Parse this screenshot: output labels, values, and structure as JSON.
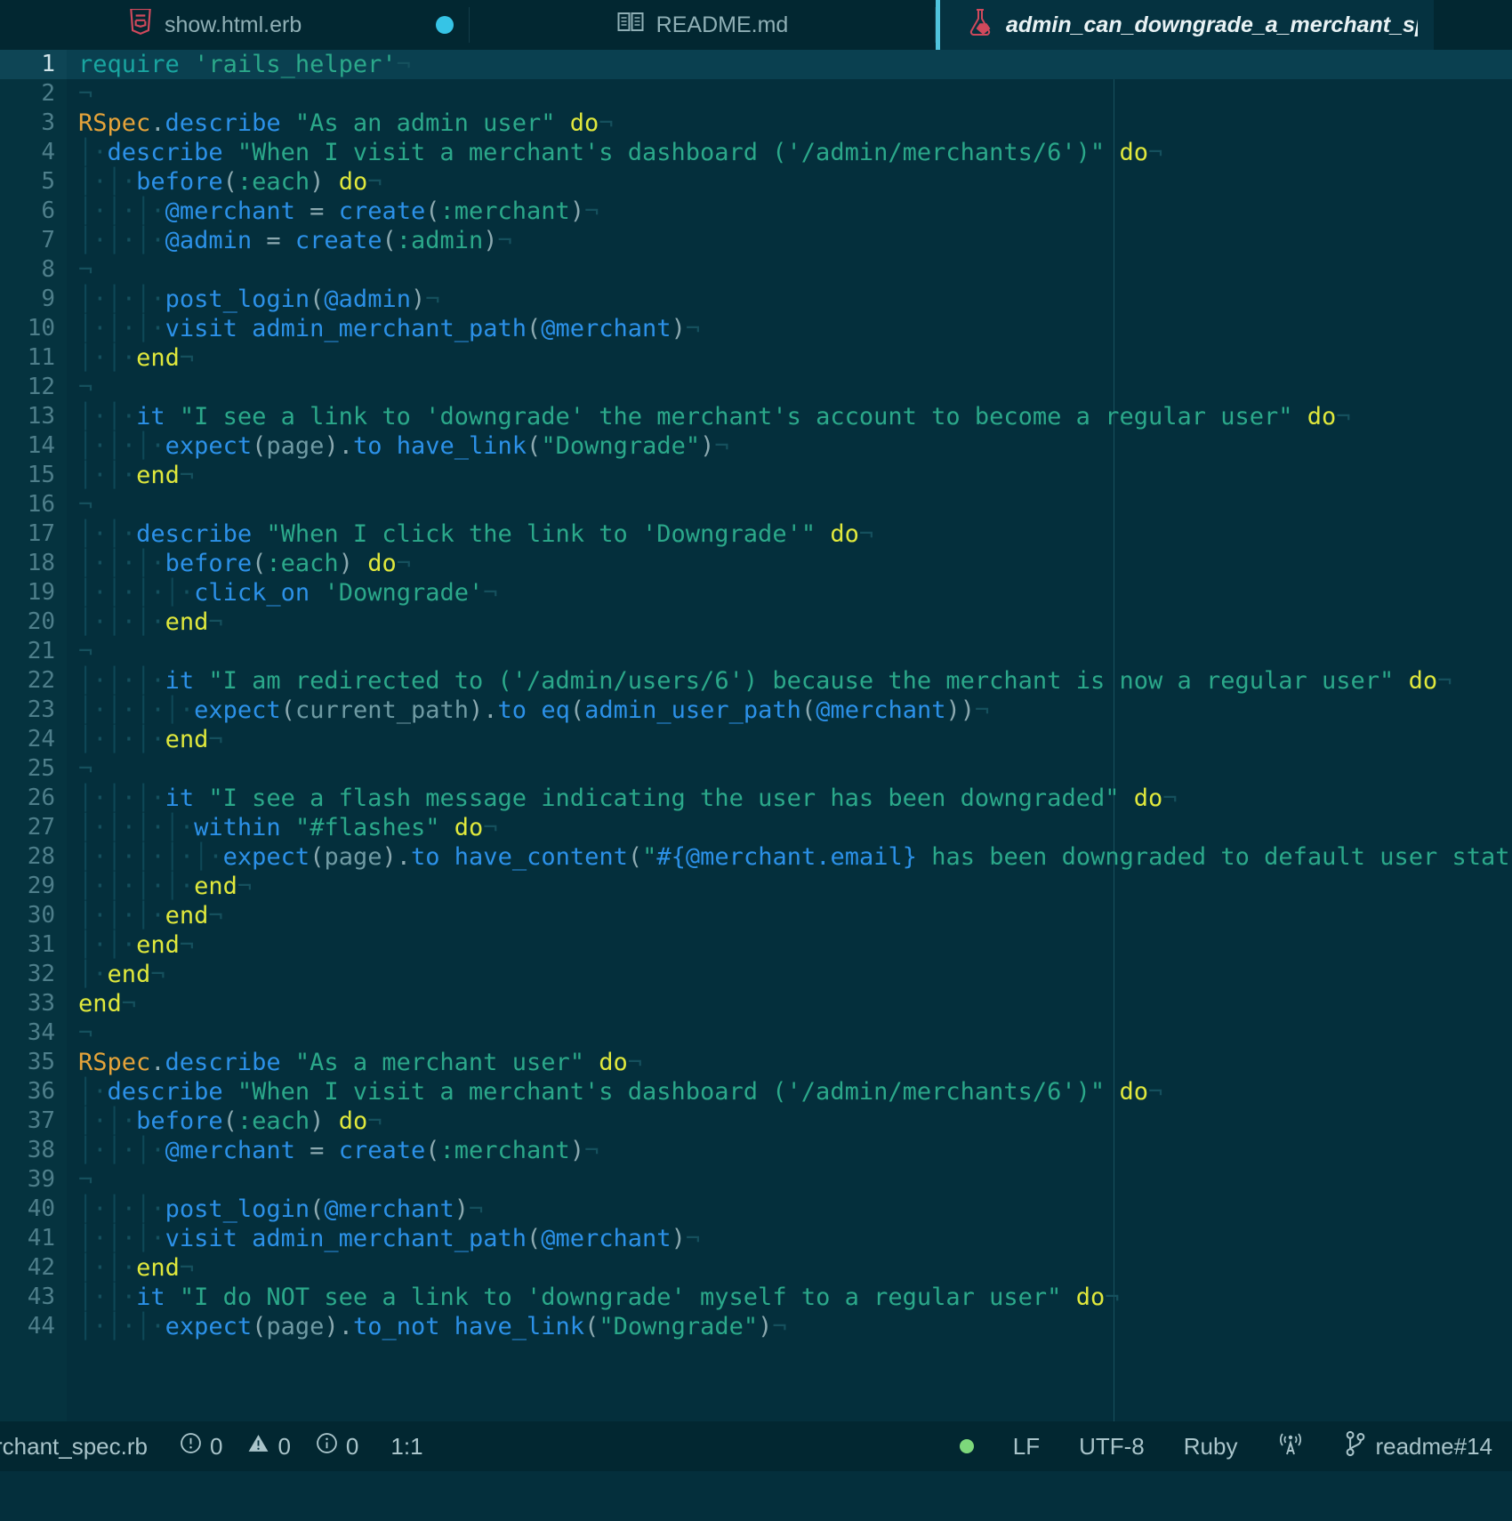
{
  "window": {
    "app": "code-editor",
    "theme_bg": "#042F3C"
  },
  "tabs": [
    {
      "label": "show.html.erb",
      "icon": "html5-icon",
      "modified": true,
      "active": false
    },
    {
      "label": "README.md",
      "icon": "book-icon",
      "modified": false,
      "active": false
    },
    {
      "label": "admin_can_downgrade_a_merchant_sp…",
      "icon": "ruby-test-flask-icon",
      "modified": false,
      "active": true
    }
  ],
  "editor": {
    "language": "Ruby",
    "current_line": 1,
    "lines": [
      {
        "n": "1",
        "indent": 0,
        "tokens": [
          {
            "t": "require",
            "c": "c-req"
          },
          {
            "t": " ",
            "c": "c-plain"
          },
          {
            "t": "'rails_helper'",
            "c": "c-str"
          }
        ]
      },
      {
        "n": "2",
        "indent": 0,
        "tokens": []
      },
      {
        "n": "3",
        "indent": 0,
        "tokens": [
          {
            "t": "RSpec",
            "c": "c-const"
          },
          {
            "t": ".",
            "c": "c-punc"
          },
          {
            "t": "describe",
            "c": "c-fn"
          },
          {
            "t": " ",
            "c": "c-plain"
          },
          {
            "t": "\"As an admin user\"",
            "c": "c-str"
          },
          {
            "t": " ",
            "c": "c-plain"
          },
          {
            "t": "do",
            "c": "c-kw"
          }
        ]
      },
      {
        "n": "4",
        "indent": 1,
        "tokens": [
          {
            "t": "describe",
            "c": "c-fn"
          },
          {
            "t": " ",
            "c": "c-plain"
          },
          {
            "t": "\"When I visit a merchant's dashboard ('/admin/merchants/6')\"",
            "c": "c-str"
          },
          {
            "t": " ",
            "c": "c-plain"
          },
          {
            "t": "do",
            "c": "c-kw"
          }
        ]
      },
      {
        "n": "5",
        "indent": 2,
        "tokens": [
          {
            "t": "before",
            "c": "c-fn"
          },
          {
            "t": "(",
            "c": "c-punc"
          },
          {
            "t": ":each",
            "c": "c-sym"
          },
          {
            "t": ")",
            "c": "c-punc"
          },
          {
            "t": " ",
            "c": "c-plain"
          },
          {
            "t": "do",
            "c": "c-kw"
          }
        ]
      },
      {
        "n": "6",
        "indent": 3,
        "tokens": [
          {
            "t": "@merchant",
            "c": "c-var"
          },
          {
            "t": " = ",
            "c": "c-punc"
          },
          {
            "t": "create",
            "c": "c-fn"
          },
          {
            "t": "(",
            "c": "c-punc"
          },
          {
            "t": ":merchant",
            "c": "c-sym"
          },
          {
            "t": ")",
            "c": "c-punc"
          }
        ]
      },
      {
        "n": "7",
        "indent": 3,
        "tokens": [
          {
            "t": "@admin",
            "c": "c-var"
          },
          {
            "t": " = ",
            "c": "c-punc"
          },
          {
            "t": "create",
            "c": "c-fn"
          },
          {
            "t": "(",
            "c": "c-punc"
          },
          {
            "t": ":admin",
            "c": "c-sym"
          },
          {
            "t": ")",
            "c": "c-punc"
          }
        ]
      },
      {
        "n": "8",
        "indent": 0,
        "tokens": []
      },
      {
        "n": "9",
        "indent": 3,
        "tokens": [
          {
            "t": "post_login",
            "c": "c-fn"
          },
          {
            "t": "(",
            "c": "c-punc"
          },
          {
            "t": "@admin",
            "c": "c-var"
          },
          {
            "t": ")",
            "c": "c-punc"
          }
        ]
      },
      {
        "n": "10",
        "indent": 3,
        "tokens": [
          {
            "t": "visit",
            "c": "c-fn"
          },
          {
            "t": " ",
            "c": "c-plain"
          },
          {
            "t": "admin_merchant_path",
            "c": "c-fn"
          },
          {
            "t": "(",
            "c": "c-punc"
          },
          {
            "t": "@merchant",
            "c": "c-var"
          },
          {
            "t": ")",
            "c": "c-punc"
          }
        ]
      },
      {
        "n": "11",
        "indent": 2,
        "tokens": [
          {
            "t": "end",
            "c": "c-kw"
          }
        ]
      },
      {
        "n": "12",
        "indent": 0,
        "tokens": []
      },
      {
        "n": "13",
        "indent": 2,
        "tokens": [
          {
            "t": "it",
            "c": "c-fn"
          },
          {
            "t": " ",
            "c": "c-plain"
          },
          {
            "t": "\"I see a link to 'downgrade' the merchant's account to become a regular user\"",
            "c": "c-str"
          },
          {
            "t": " ",
            "c": "c-plain"
          },
          {
            "t": "do",
            "c": "c-kw"
          }
        ]
      },
      {
        "n": "14",
        "indent": 3,
        "tokens": [
          {
            "t": "expect",
            "c": "c-fn"
          },
          {
            "t": "(",
            "c": "c-punc"
          },
          {
            "t": "page",
            "c": "c-plain"
          },
          {
            "t": ").",
            "c": "c-punc"
          },
          {
            "t": "to",
            "c": "c-fn"
          },
          {
            "t": " ",
            "c": "c-plain"
          },
          {
            "t": "have_link",
            "c": "c-fn"
          },
          {
            "t": "(",
            "c": "c-punc"
          },
          {
            "t": "\"Downgrade\"",
            "c": "c-str"
          },
          {
            "t": ")",
            "c": "c-punc"
          }
        ]
      },
      {
        "n": "15",
        "indent": 2,
        "tokens": [
          {
            "t": "end",
            "c": "c-kw"
          }
        ]
      },
      {
        "n": "16",
        "indent": 0,
        "tokens": []
      },
      {
        "n": "17",
        "indent": 2,
        "tokens": [
          {
            "t": "describe",
            "c": "c-fn"
          },
          {
            "t": " ",
            "c": "c-plain"
          },
          {
            "t": "\"When I click the link to 'Downgrade'\"",
            "c": "c-str"
          },
          {
            "t": " ",
            "c": "c-plain"
          },
          {
            "t": "do",
            "c": "c-kw"
          }
        ]
      },
      {
        "n": "18",
        "indent": 3,
        "tokens": [
          {
            "t": "before",
            "c": "c-fn"
          },
          {
            "t": "(",
            "c": "c-punc"
          },
          {
            "t": ":each",
            "c": "c-sym"
          },
          {
            "t": ")",
            "c": "c-punc"
          },
          {
            "t": " ",
            "c": "c-plain"
          },
          {
            "t": "do",
            "c": "c-kw"
          }
        ]
      },
      {
        "n": "19",
        "indent": 4,
        "tokens": [
          {
            "t": "click_on",
            "c": "c-fn"
          },
          {
            "t": " ",
            "c": "c-plain"
          },
          {
            "t": "'Downgrade'",
            "c": "c-str"
          }
        ]
      },
      {
        "n": "20",
        "indent": 3,
        "tokens": [
          {
            "t": "end",
            "c": "c-kw"
          }
        ]
      },
      {
        "n": "21",
        "indent": 0,
        "tokens": []
      },
      {
        "n": "22",
        "indent": 3,
        "tokens": [
          {
            "t": "it",
            "c": "c-fn"
          },
          {
            "t": " ",
            "c": "c-plain"
          },
          {
            "t": "\"I am redirected to ('/admin/users/6') because the merchant is now a regular user\"",
            "c": "c-str"
          },
          {
            "t": " ",
            "c": "c-plain"
          },
          {
            "t": "do",
            "c": "c-kw"
          }
        ]
      },
      {
        "n": "23",
        "indent": 4,
        "tokens": [
          {
            "t": "expect",
            "c": "c-fn"
          },
          {
            "t": "(",
            "c": "c-punc"
          },
          {
            "t": "current_path",
            "c": "c-plain"
          },
          {
            "t": ").",
            "c": "c-punc"
          },
          {
            "t": "to",
            "c": "c-fn"
          },
          {
            "t": " ",
            "c": "c-plain"
          },
          {
            "t": "eq",
            "c": "c-fn"
          },
          {
            "t": "(",
            "c": "c-punc"
          },
          {
            "t": "admin_user_path",
            "c": "c-fn"
          },
          {
            "t": "(",
            "c": "c-punc"
          },
          {
            "t": "@merchant",
            "c": "c-var"
          },
          {
            "t": "))",
            "c": "c-punc"
          }
        ]
      },
      {
        "n": "24",
        "indent": 3,
        "tokens": [
          {
            "t": "end",
            "c": "c-kw"
          }
        ]
      },
      {
        "n": "25",
        "indent": 0,
        "tokens": []
      },
      {
        "n": "26",
        "indent": 3,
        "tokens": [
          {
            "t": "it",
            "c": "c-fn"
          },
          {
            "t": " ",
            "c": "c-plain"
          },
          {
            "t": "\"I see a flash message indicating the user has been downgraded\"",
            "c": "c-str"
          },
          {
            "t": " ",
            "c": "c-plain"
          },
          {
            "t": "do",
            "c": "c-kw"
          }
        ]
      },
      {
        "n": "27",
        "indent": 4,
        "tokens": [
          {
            "t": "within",
            "c": "c-fn"
          },
          {
            "t": " ",
            "c": "c-plain"
          },
          {
            "t": "\"#flashes\"",
            "c": "c-str"
          },
          {
            "t": " ",
            "c": "c-plain"
          },
          {
            "t": "do",
            "c": "c-kw"
          }
        ]
      },
      {
        "n": "28",
        "indent": 5,
        "tokens": [
          {
            "t": "expect",
            "c": "c-fn"
          },
          {
            "t": "(",
            "c": "c-punc"
          },
          {
            "t": "page",
            "c": "c-plain"
          },
          {
            "t": ").",
            "c": "c-punc"
          },
          {
            "t": "to",
            "c": "c-fn"
          },
          {
            "t": " ",
            "c": "c-plain"
          },
          {
            "t": "have_content",
            "c": "c-fn"
          },
          {
            "t": "(",
            "c": "c-punc"
          },
          {
            "t": "\"",
            "c": "c-str"
          },
          {
            "t": "#{@merchant.email}",
            "c": "c-var"
          },
          {
            "t": " has been downgraded to default user status.\"",
            "c": "c-str"
          },
          {
            "t": ")",
            "c": "c-punc"
          }
        ]
      },
      {
        "n": "29",
        "indent": 4,
        "tokens": [
          {
            "t": "end",
            "c": "c-kw"
          }
        ]
      },
      {
        "n": "30",
        "indent": 3,
        "tokens": [
          {
            "t": "end",
            "c": "c-kw"
          }
        ]
      },
      {
        "n": "31",
        "indent": 2,
        "tokens": [
          {
            "t": "end",
            "c": "c-kw"
          }
        ]
      },
      {
        "n": "32",
        "indent": 1,
        "tokens": [
          {
            "t": "end",
            "c": "c-kw"
          }
        ]
      },
      {
        "n": "33",
        "indent": 0,
        "tokens": [
          {
            "t": "end",
            "c": "c-kw"
          }
        ]
      },
      {
        "n": "34",
        "indent": 0,
        "tokens": []
      },
      {
        "n": "35",
        "indent": 0,
        "tokens": [
          {
            "t": "RSpec",
            "c": "c-const"
          },
          {
            "t": ".",
            "c": "c-punc"
          },
          {
            "t": "describe",
            "c": "c-fn"
          },
          {
            "t": " ",
            "c": "c-plain"
          },
          {
            "t": "\"As a merchant user\"",
            "c": "c-str"
          },
          {
            "t": " ",
            "c": "c-plain"
          },
          {
            "t": "do",
            "c": "c-kw"
          }
        ]
      },
      {
        "n": "36",
        "indent": 1,
        "tokens": [
          {
            "t": "describe",
            "c": "c-fn"
          },
          {
            "t": " ",
            "c": "c-plain"
          },
          {
            "t": "\"When I visit a merchant's dashboard ('/admin/merchants/6')\"",
            "c": "c-str"
          },
          {
            "t": " ",
            "c": "c-plain"
          },
          {
            "t": "do",
            "c": "c-kw"
          }
        ]
      },
      {
        "n": "37",
        "indent": 2,
        "tokens": [
          {
            "t": "before",
            "c": "c-fn"
          },
          {
            "t": "(",
            "c": "c-punc"
          },
          {
            "t": ":each",
            "c": "c-sym"
          },
          {
            "t": ")",
            "c": "c-punc"
          },
          {
            "t": " ",
            "c": "c-plain"
          },
          {
            "t": "do",
            "c": "c-kw"
          }
        ]
      },
      {
        "n": "38",
        "indent": 3,
        "tokens": [
          {
            "t": "@merchant",
            "c": "c-var"
          },
          {
            "t": " = ",
            "c": "c-punc"
          },
          {
            "t": "create",
            "c": "c-fn"
          },
          {
            "t": "(",
            "c": "c-punc"
          },
          {
            "t": ":merchant",
            "c": "c-sym"
          },
          {
            "t": ")",
            "c": "c-punc"
          }
        ]
      },
      {
        "n": "39",
        "indent": 0,
        "tokens": []
      },
      {
        "n": "40",
        "indent": 3,
        "tokens": [
          {
            "t": "post_login",
            "c": "c-fn"
          },
          {
            "t": "(",
            "c": "c-punc"
          },
          {
            "t": "@merchant",
            "c": "c-var"
          },
          {
            "t": ")",
            "c": "c-punc"
          }
        ]
      },
      {
        "n": "41",
        "indent": 3,
        "tokens": [
          {
            "t": "visit",
            "c": "c-fn"
          },
          {
            "t": " ",
            "c": "c-plain"
          },
          {
            "t": "admin_merchant_path",
            "c": "c-fn"
          },
          {
            "t": "(",
            "c": "c-punc"
          },
          {
            "t": "@merchant",
            "c": "c-var"
          },
          {
            "t": ")",
            "c": "c-punc"
          }
        ]
      },
      {
        "n": "42",
        "indent": 2,
        "tokens": [
          {
            "t": "end",
            "c": "c-kw"
          }
        ]
      },
      {
        "n": "43",
        "indent": 2,
        "tokens": [
          {
            "t": "it",
            "c": "c-fn"
          },
          {
            "t": " ",
            "c": "c-plain"
          },
          {
            "t": "\"I do NOT see a link to 'downgrade' myself to a regular user\"",
            "c": "c-str"
          },
          {
            "t": " ",
            "c": "c-plain"
          },
          {
            "t": "do",
            "c": "c-kw"
          }
        ]
      },
      {
        "n": "44",
        "indent": 3,
        "tokens": [
          {
            "t": "expect",
            "c": "c-fn"
          },
          {
            "t": "(",
            "c": "c-punc"
          },
          {
            "t": "page",
            "c": "c-plain"
          },
          {
            "t": ").",
            "c": "c-punc"
          },
          {
            "t": "to_not",
            "c": "c-fn"
          },
          {
            "t": " ",
            "c": "c-plain"
          },
          {
            "t": "have_link",
            "c": "c-fn"
          },
          {
            "t": "(",
            "c": "c-punc"
          },
          {
            "t": "\"Downgrade\"",
            "c": "c-str"
          },
          {
            "t": ")",
            "c": "c-punc"
          }
        ]
      }
    ]
  },
  "statusbar": {
    "filename": "rchant_spec.rb",
    "errors": "0",
    "warnings": "0",
    "infos": "0",
    "cursor_position": "1:1",
    "line_ending": "LF",
    "encoding": "UTF-8",
    "language": "Ruby",
    "branch": "readme#14",
    "sync_dot_color": "#7DD87B"
  }
}
